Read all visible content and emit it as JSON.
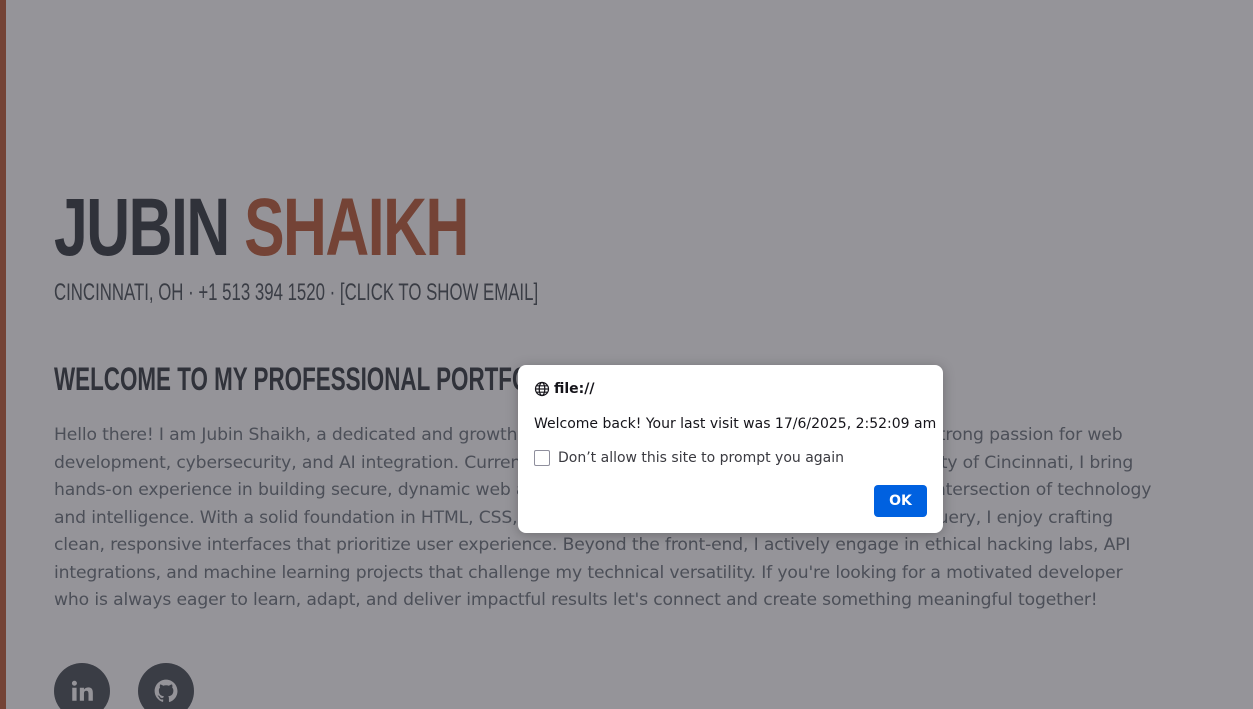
{
  "resume": {
    "first_name": "Jubin",
    "last_name": "Shaikh",
    "location": "Cincinnati, OH",
    "phone": "+1 513 394 1520",
    "separator": "·",
    "email_toggle": "[click to show email]",
    "welcome_heading": "Welcome to my professional portfolio!",
    "bio": "Hello there! I am Jubin Shaikh, a dedicated and growth-oriented Information Technology student with a strong passion for web development, cybersecurity, and AI integration. Currently pursuing my Bachelor's degree at the University of Cincinnati, I bring hands-on experience in building secure, dynamic web applications and a keen interest in exploring the intersection of technology and intelligence. With a solid foundation in HTML, CSS, JavaScript, and frameworks like Bootstrap and jQuery, I enjoy crafting clean, responsive interfaces that prioritize user experience. Beyond the front-end, I actively engage in ethical hacking labs, API integrations, and machine learning projects that challenge my technical versatility. If you're looking for a motivated developer who is always eager to learn, adapt, and deliver impactful results let's connect and create something meaningful together!",
    "social_icons": [
      "linkedin-icon",
      "github-icon"
    ]
  },
  "dialog": {
    "origin": "file://",
    "message": "Welcome back! Your last visit was 17/6/2025, 2:52:09 am",
    "checkbox_label": "Don’t allow this site to prompt you again",
    "checkbox_checked": false,
    "ok_label": "OK",
    "icon": "globe-icon"
  },
  "colors": {
    "accent": "#bd5d38",
    "heading": "#343a40",
    "body_text": "#6c757d",
    "primary_button": "#0061e0",
    "overlay": "rgba(43,42,51,0.5)"
  }
}
